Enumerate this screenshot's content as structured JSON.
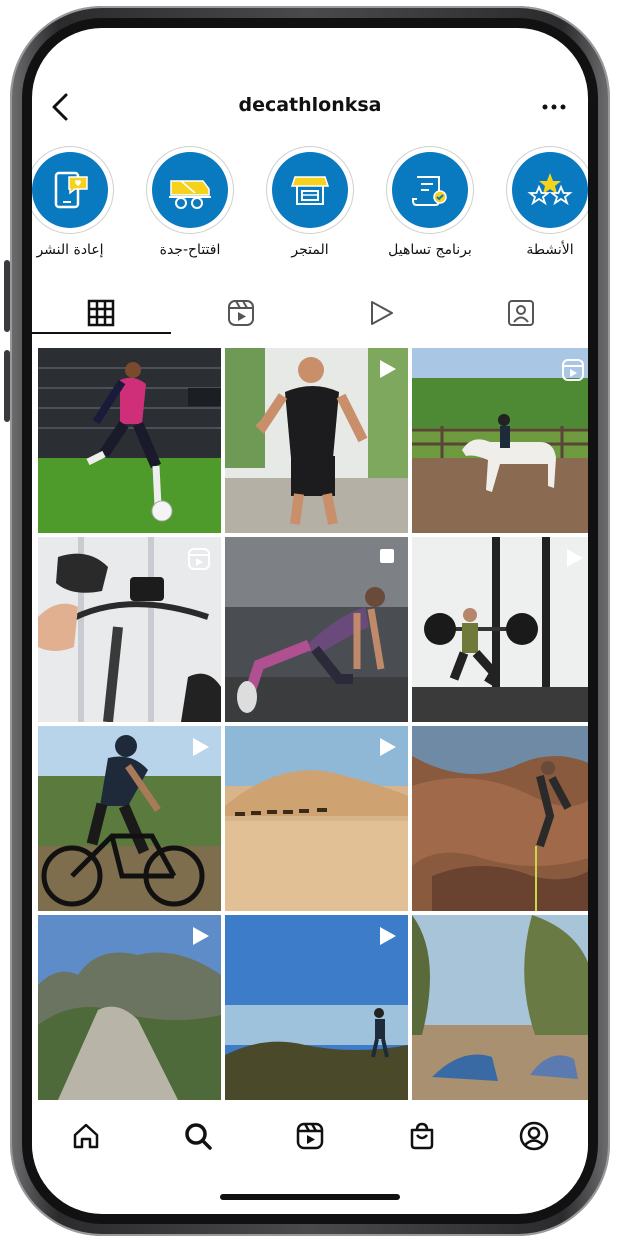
{
  "header": {
    "title": "decathlonksa",
    "back_icon": "back-chevron-icon",
    "more_icon": "more-options-icon"
  },
  "highlights": [
    {
      "label": "الأنشطة",
      "icon": "stars-icon"
    },
    {
      "label": "برنامج تساهيل",
      "icon": "contract-icon"
    },
    {
      "label": "المتجر",
      "icon": "store-icon"
    },
    {
      "label": "افتتاح-جدة",
      "icon": "truck-icon"
    },
    {
      "label": "إعادة النشر",
      "icon": "phone-message-icon"
    }
  ],
  "tabs": [
    {
      "name": "grid",
      "icon": "grid-icon",
      "active": true
    },
    {
      "name": "reels",
      "icon": "reels-icon"
    },
    {
      "name": "videos",
      "icon": "play-icon"
    },
    {
      "name": "tagged",
      "icon": "tagged-icon"
    }
  ],
  "posts": [
    {
      "scene": "football",
      "badge": "none"
    },
    {
      "scene": "runner",
      "badge": "video"
    },
    {
      "scene": "horse",
      "badge": "reel"
    },
    {
      "scene": "bike-handlebar",
      "badge": "reel"
    },
    {
      "scene": "gym-lunge",
      "badge": "multi"
    },
    {
      "scene": "weights",
      "badge": "video"
    },
    {
      "scene": "cyclist",
      "badge": "video"
    },
    {
      "scene": "desert",
      "badge": "video"
    },
    {
      "scene": "climbing",
      "badge": "none"
    },
    {
      "scene": "mountains",
      "badge": "video"
    },
    {
      "scene": "hiker",
      "badge": "video"
    },
    {
      "scene": "camping",
      "badge": "none"
    }
  ],
  "bottom_nav": [
    {
      "name": "home",
      "icon": "home-icon"
    },
    {
      "name": "search",
      "icon": "search-icon",
      "active": true
    },
    {
      "name": "reels",
      "icon": "reels-icon"
    },
    {
      "name": "shop",
      "icon": "shop-icon"
    },
    {
      "name": "profile",
      "icon": "profile-icon"
    }
  ],
  "colors": {
    "highlight_blue": "#0a7ac0",
    "accent_yellow": "#f6d21c",
    "text": "#111111"
  }
}
